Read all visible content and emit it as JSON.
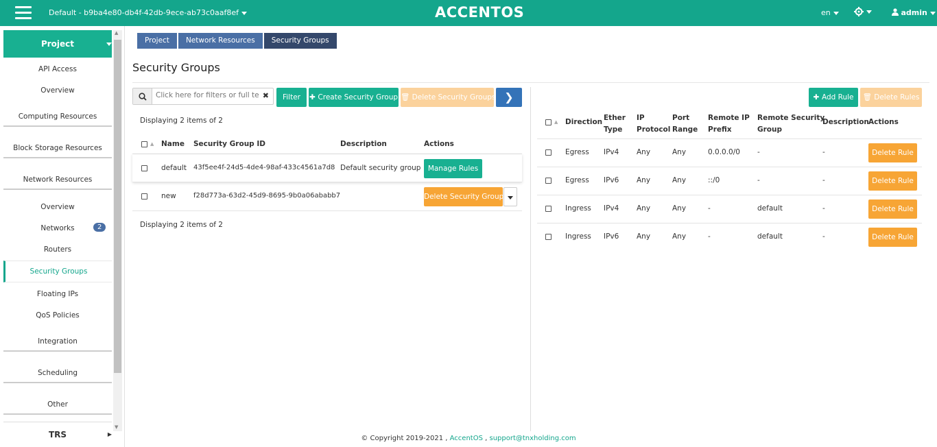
{
  "topbar": {
    "tenant": "Default - b9ba4e80-db4f-42db-9ece-ab73c0aaf8ef",
    "logo": "ACCENTOS",
    "lang": "en",
    "user": "admin"
  },
  "sidebar": {
    "project": "Project",
    "items": [
      {
        "label": "API Access"
      },
      {
        "label": "Overview"
      },
      {
        "label": "Computing Resources"
      },
      {
        "label": "Block Storage Resources"
      },
      {
        "label": "Network Resources"
      },
      {
        "label": "Overview"
      },
      {
        "label": "Networks",
        "badge": "2"
      },
      {
        "label": "Routers"
      },
      {
        "label": "Security Groups"
      },
      {
        "label": "Floating IPs"
      },
      {
        "label": "QoS Policies"
      },
      {
        "label": "Integration"
      },
      {
        "label": "Scheduling"
      },
      {
        "label": "Other"
      }
    ],
    "trs": "TRS"
  },
  "breadcrumb": [
    "Project",
    "Network Resources",
    "Security Groups"
  ],
  "page_title": "Security Groups",
  "left": {
    "search_placeholder": "Click here for filters or full text...",
    "filter_label": "Filter",
    "create_label": "Create Security Group",
    "delete_label": "Delete Security Groups",
    "display_text": "Displaying 2 items of 2",
    "columns": [
      "Name",
      "Security Group ID",
      "Description",
      "Actions"
    ],
    "rows": [
      {
        "name": "default",
        "id": "43f5ee4f-24d5-4de4-98af-433c4561a7d8",
        "description": "Default security group",
        "action": "Manage Rules"
      },
      {
        "name": "new",
        "id": "f28d773a-63d2-45d9-8695-9b0a06ababb7",
        "description": "",
        "action": "Delete Security Group"
      }
    ]
  },
  "right": {
    "add_rule": "Add Rule",
    "delete_rules": "Delete Rules",
    "columns": [
      "Direction",
      "Ether Type",
      "IP Protocol",
      "Port Range",
      "Remote IP Prefix",
      "Remote Security Group",
      "Description",
      "Actions"
    ],
    "col_lines": [
      [
        "Direction"
      ],
      [
        "Ether",
        "Type"
      ],
      [
        "IP",
        "Protocol"
      ],
      [
        "Port",
        "Range"
      ],
      [
        "Remote IP",
        "Prefix"
      ],
      [
        "Remote Security",
        "Group"
      ],
      [
        "Description"
      ],
      [
        "Actions"
      ]
    ],
    "rows": [
      {
        "direction": "Egress",
        "ether": "IPv4",
        "proto": "Any",
        "port": "Any",
        "prefix": "0.0.0.0/0",
        "group": "-",
        "desc": "-",
        "action": "Delete Rule"
      },
      {
        "direction": "Egress",
        "ether": "IPv6",
        "proto": "Any",
        "port": "Any",
        "prefix": "::/0",
        "group": "-",
        "desc": "-",
        "action": "Delete Rule"
      },
      {
        "direction": "Ingress",
        "ether": "IPv4",
        "proto": "Any",
        "port": "Any",
        "prefix": "-",
        "group": "default",
        "desc": "-",
        "action": "Delete Rule"
      },
      {
        "direction": "Ingress",
        "ether": "IPv6",
        "proto": "Any",
        "port": "Any",
        "prefix": "-",
        "group": "default",
        "desc": "-",
        "action": "Delete Rule"
      }
    ]
  },
  "footer": {
    "copyright": "© Copyright 2019-2021 ,",
    "brand": "AccentOS",
    "sep": ",",
    "email": "support@tnxholding.com"
  },
  "colors": {
    "brand": "#14a68c",
    "orange": "#f7a535",
    "blue": "#4a6fa5"
  },
  "icons": [
    "menu-icon",
    "gear-icon",
    "user-icon",
    "search-icon",
    "close-icon",
    "plus-icon",
    "trash-icon",
    "chevron-right-icon",
    "caret-down-icon"
  ]
}
